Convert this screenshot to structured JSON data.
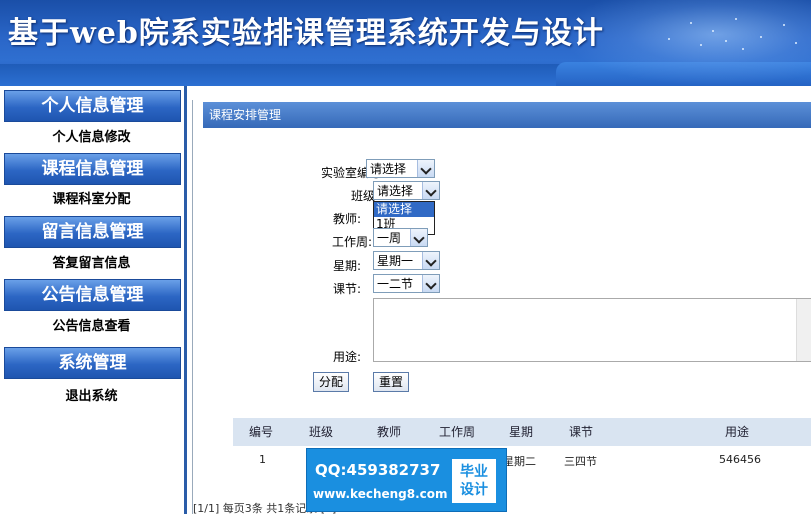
{
  "banner": {
    "title": "基于web院系实验排课管理系统开发与设计"
  },
  "sidebar": {
    "sections": [
      {
        "heading": "个人信息管理",
        "items": [
          "个人信息修改"
        ]
      },
      {
        "heading": "课程信息管理",
        "items": [
          "课程科室分配"
        ]
      },
      {
        "heading": "留言信息管理",
        "items": [
          "答复留言信息"
        ]
      },
      {
        "heading": "公告信息管理",
        "items": [
          "公告信息查看"
        ]
      },
      {
        "heading": "系统管理",
        "items": [
          "退出系统"
        ]
      }
    ]
  },
  "panel": {
    "title": "课程安排管理",
    "form": {
      "lab_label": "实验室编号:",
      "lab_value": "请选择",
      "class_label": "班级:",
      "class_value": "请选择",
      "class_options": [
        "请选择",
        "1班"
      ],
      "teacher_label": "教师:",
      "week_label": "工作周:",
      "week_value": "一周",
      "day_label": "星期:",
      "day_value": "星期一",
      "period_label": "课节:",
      "period_value": "一二节",
      "purpose_label": "用途:",
      "submit_label": "分配",
      "reset_label": "重置"
    },
    "table": {
      "headers": [
        "编号",
        "班级",
        "教师",
        "工作周",
        "星期",
        "课节",
        "用途"
      ],
      "rows": [
        [
          "1",
          "",
          "",
          "",
          "星期二",
          "三四节",
          "546456"
        ]
      ]
    },
    "pagination": "[1/1] 每页3条 共1条记录 [1]"
  },
  "watermark": {
    "qq": "QQ:459382737",
    "url": "www.kecheng8.com",
    "badge_line1": "毕业",
    "badge_line2": "设计"
  },
  "colors": {
    "banner": "#2a66c8",
    "sidebar_head": "#2c66c4",
    "panel_head": "#3569b8",
    "highlight": "#316ac5",
    "watermark": "#1a8fe0"
  }
}
